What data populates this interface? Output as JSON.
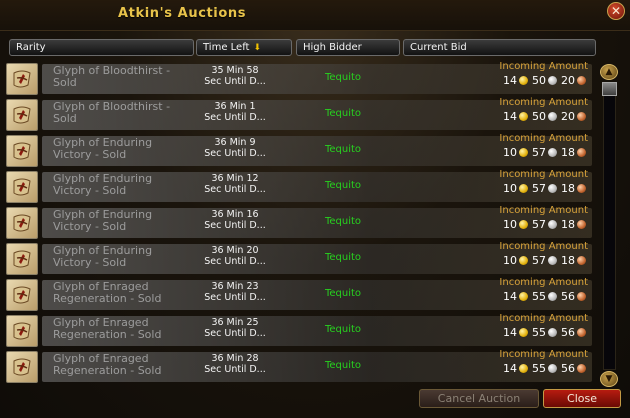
{
  "window": {
    "title": "Atkin's Auctions",
    "close_label": "✕"
  },
  "columns": {
    "rarity": "Rarity",
    "time_left": "Time Left",
    "high_bidder": "High Bidder",
    "current_bid": "Current Bid"
  },
  "incoming_label": "Incoming Amount",
  "rows": [
    {
      "name": "Glyph of Bloodthirst -\nSold",
      "time": "35 Min 58\nSec Until D...",
      "bidder": "Tequito",
      "gold": "14",
      "silver": "50",
      "copper": "20"
    },
    {
      "name": "Glyph of Bloodthirst -\nSold",
      "time": "36 Min 1\nSec Until D...",
      "bidder": "Tequito",
      "gold": "14",
      "silver": "50",
      "copper": "20"
    },
    {
      "name": "Glyph of Enduring\nVictory - Sold",
      "time": "36 Min 9\nSec Until D...",
      "bidder": "Tequito",
      "gold": "10",
      "silver": "57",
      "copper": "18"
    },
    {
      "name": "Glyph of Enduring\nVictory - Sold",
      "time": "36 Min 12\nSec Until D...",
      "bidder": "Tequito",
      "gold": "10",
      "silver": "57",
      "copper": "18"
    },
    {
      "name": "Glyph of Enduring\nVictory - Sold",
      "time": "36 Min 16\nSec Until D...",
      "bidder": "Tequito",
      "gold": "10",
      "silver": "57",
      "copper": "18"
    },
    {
      "name": "Glyph of Enduring\nVictory - Sold",
      "time": "36 Min 20\nSec Until D...",
      "bidder": "Tequito",
      "gold": "10",
      "silver": "57",
      "copper": "18"
    },
    {
      "name": "Glyph of Enraged\nRegeneration - Sold",
      "time": "36 Min 23\nSec Until D...",
      "bidder": "Tequito",
      "gold": "14",
      "silver": "55",
      "copper": "56"
    },
    {
      "name": "Glyph of Enraged\nRegeneration - Sold",
      "time": "36 Min 25\nSec Until D...",
      "bidder": "Tequito",
      "gold": "14",
      "silver": "55",
      "copper": "56"
    },
    {
      "name": "Glyph of Enraged\nRegeneration - Sold",
      "time": "36 Min 28\nSec Until D...",
      "bidder": "Tequito",
      "gold": "14",
      "silver": "55",
      "copper": "56"
    }
  ],
  "buttons": {
    "cancel": "Cancel Auction",
    "close": "Close"
  },
  "icons": {
    "row_icon": "glyph-scroll-icon",
    "sort": "sort-arrow-icon",
    "scroll_up": "scroll-up-icon",
    "scroll_down": "scroll-down-icon"
  },
  "colors": {
    "title": "#e8c34a",
    "bidder": "#27d11f",
    "incoming": "#d7a23a",
    "item_sold": "#9c9c9c"
  }
}
